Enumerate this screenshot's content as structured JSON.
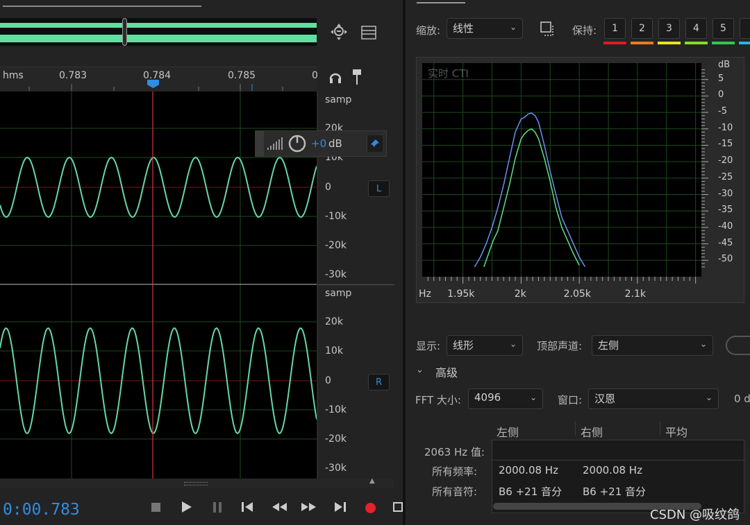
{
  "waveform": {
    "ruler": {
      "unit": "hms",
      "ticks": [
        "0.783",
        "0.784",
        "0.785",
        "0"
      ]
    },
    "amp_upper": [
      "samp",
      "20k",
      "10k",
      "0",
      "-10k",
      "-20k",
      "-30k"
    ],
    "amp_lower": [
      "samp",
      "20k",
      "10k",
      "0",
      "-10k",
      "-20k",
      "-30k"
    ],
    "hud": {
      "value": "+0",
      "unit": "dB"
    },
    "channels": {
      "left": "L",
      "right": "R"
    },
    "time_display": "0:00.783",
    "colors": {
      "wave": "#67d8a8",
      "playhead": "#d93a3a",
      "accent": "#2f8de4"
    }
  },
  "frequency": {
    "zoom_label": "缩放:",
    "zoom_value": "线性",
    "hold_label": "保持:",
    "hold_buttons": [
      "1",
      "2",
      "3",
      "4",
      "5"
    ],
    "hold_colors": [
      "#e21b1b",
      "#f07a1c",
      "#e8e31e",
      "#7fe01e",
      "#2fc84e"
    ],
    "display_label": "显示:",
    "display_value": "线形",
    "top_channel_label": "顶部声道:",
    "top_channel_value": "左侧",
    "advanced_label": "高级",
    "fft_label": "FFT 大小:",
    "fft_value": "4096",
    "window_label": "窗口:",
    "window_value": "汉恩",
    "db_partial": "0 d",
    "table": {
      "headers": [
        "左侧",
        "右侧",
        "平均"
      ],
      "rows": [
        {
          "label": "2063 Hz 值:",
          "left": "",
          "right": ""
        },
        {
          "label": "所有频率:",
          "left": "2000.08 Hz",
          "right": "2000.08 Hz"
        },
        {
          "label": "所有音符:",
          "left": "B6 +21 音分",
          "right": "B6 +21 音分"
        }
      ]
    }
  },
  "chart_data": {
    "type": "line",
    "title": "实时 CTI",
    "xlabel": "Hz",
    "ylabel": "dB",
    "x_ticks": [
      "1.95k",
      "2k",
      "2.05k",
      "2.1k"
    ],
    "y_ticks": [
      "5",
      "0",
      "-5",
      "-10",
      "-15",
      "-20",
      "-25",
      "-30",
      "-35",
      "-40",
      "-45",
      "-50"
    ],
    "xlim": [
      1915,
      2155
    ],
    "ylim": [
      -55,
      10
    ],
    "grid": true,
    "series": [
      {
        "color": "#6f8ff0",
        "x": [
          1960,
          1965,
          1970,
          1975,
          1980,
          1985,
          1990,
          1995,
          2000,
          2003,
          2006,
          2009,
          2012,
          2015,
          2020,
          2025,
          2030,
          2035,
          2040,
          2045,
          2050,
          2055
        ],
        "y": [
          -52,
          -49,
          -45,
          -40,
          -34,
          -27,
          -19,
          -11,
          -7,
          -6.5,
          -5.5,
          -5.2,
          -6,
          -8,
          -15,
          -23,
          -30,
          -37,
          -41,
          -45,
          -49,
          -52
        ]
      },
      {
        "color": "#5fe08c",
        "x": [
          1968,
          1972,
          1976,
          1980,
          1985,
          1990,
          1995,
          2000,
          2003,
          2006,
          2009,
          2012,
          2015,
          2020,
          2025,
          2030,
          2035,
          2040,
          2045,
          2050
        ],
        "y": [
          -52,
          -48,
          -44,
          -41,
          -34,
          -27,
          -19,
          -13,
          -11.5,
          -10.5,
          -10,
          -11,
          -13,
          -19,
          -26,
          -34,
          -40,
          -44,
          -48,
          -51.5
        ]
      }
    ]
  },
  "watermark": "CSDN @吸纹鸽"
}
